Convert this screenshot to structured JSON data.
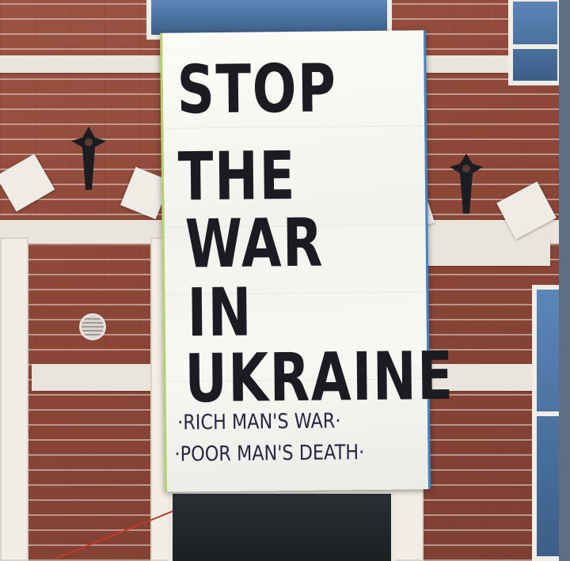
{
  "banner": {
    "line1": "STOP",
    "line2": "THE",
    "line3": "WAR",
    "line4": "IN",
    "line5": "UKRAINE",
    "line6": "·RICH MAN'S WAR·",
    "line7": "·POOR MAN'S DEATH·"
  },
  "colors": {
    "brick": "#8c4637",
    "mortar": "#e9e4dc",
    "banner": "#f7f7f4",
    "paint": "#1a1c22",
    "small_paint": "#2a2540",
    "window_glass": "#4a72a3"
  },
  "icons": [
    "wall-anchor-icon",
    "air-vent-icon"
  ]
}
